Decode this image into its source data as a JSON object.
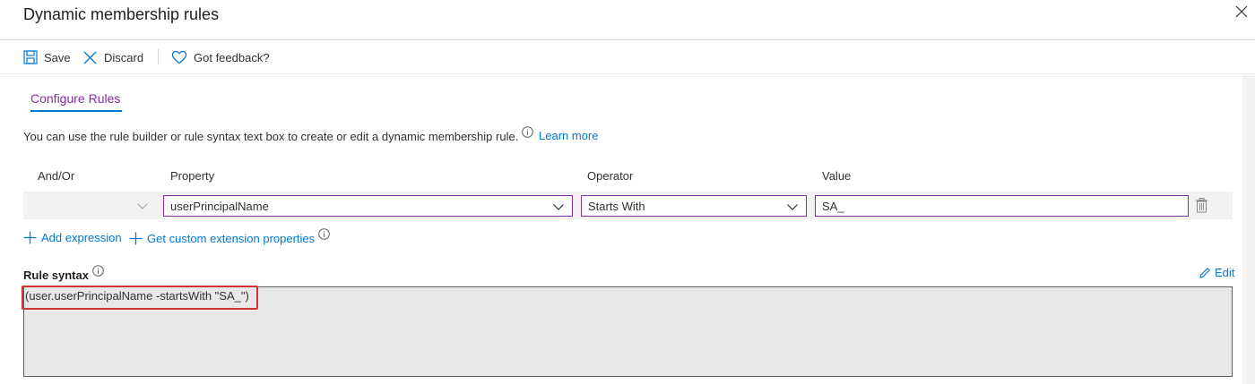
{
  "title": "Dynamic membership rules",
  "toolbar": {
    "save_label": "Save",
    "discard_label": "Discard",
    "feedback_label": "Got feedback?"
  },
  "tabs": [
    {
      "label": "Configure Rules",
      "active": true
    }
  ],
  "description": "You can use the rule builder or rule syntax text box to create or edit a dynamic membership rule.",
  "learn_more": "Learn more",
  "columns": {
    "andor": "And/Or",
    "property": "Property",
    "operator": "Operator",
    "value": "Value"
  },
  "rule_row": {
    "andor": "",
    "property": "userPrincipalName",
    "operator": "Starts With",
    "value": "SA_"
  },
  "actions": {
    "add_expression": "Add expression",
    "custom_extension": "Get custom extension properties"
  },
  "syntax": {
    "label": "Rule syntax",
    "edit_label": "Edit",
    "text": "(user.userPrincipalName -startsWith \"SA_\")"
  },
  "colors": {
    "accent_purple": "#8a2da5",
    "link_blue": "#0078d4",
    "highlight_red": "#d13438"
  },
  "icons": [
    "close-icon",
    "save-icon",
    "discard-icon",
    "heart-icon",
    "info-icon",
    "chevron-down-icon",
    "trash-icon",
    "plus-icon",
    "pencil-icon"
  ]
}
